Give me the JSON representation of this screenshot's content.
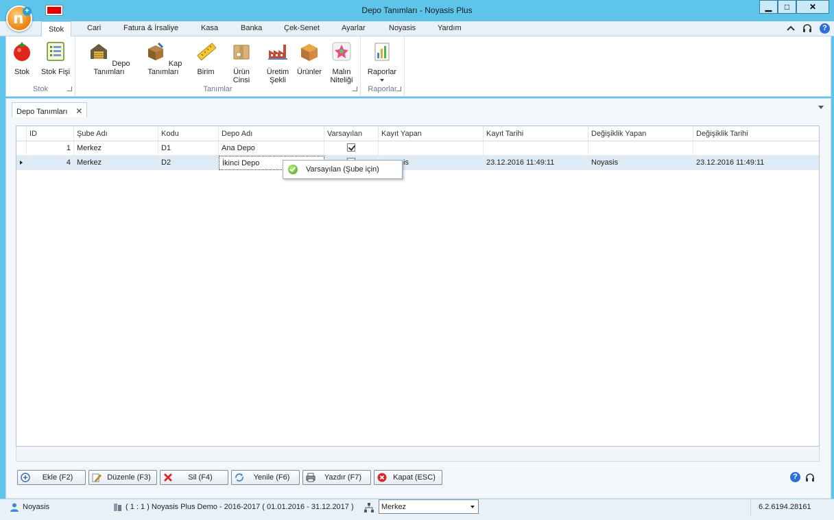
{
  "window": {
    "title": "Depo Tanımları - Noyasis Plus",
    "min": "▁",
    "max": "□",
    "close": "✕"
  },
  "ribbon": {
    "tabs": [
      "Stok",
      "Cari",
      "Fatura & İrsaliye",
      "Kasa",
      "Banka",
      "Çek-Senet",
      "Ayarlar",
      "Noyasis",
      "Yardım"
    ],
    "groups": {
      "stok": {
        "label": "Stok",
        "buttons": [
          "Stok",
          "Stok Fişi"
        ]
      },
      "tanimlar": {
        "label": "Tanımlar",
        "buttons": [
          "Depo Tanımları",
          "Kap Tanımları",
          "Birim",
          "Ürün Cinsi",
          "Üretim Şekli",
          "Ürünler",
          "Malın Niteliği"
        ]
      },
      "raporlar": {
        "label": "Raporlar",
        "buttons": [
          "Raporlar"
        ]
      }
    }
  },
  "document": {
    "tab": "Depo Tanımları",
    "tab_close": "✕"
  },
  "grid": {
    "columns": [
      "ID",
      "Şube Adı",
      "Kodu",
      "Depo Adı",
      "Varsayılan",
      "Kayıt Yapan",
      "Kayıt Tarihi",
      "Değişiklik Yapan",
      "Değişiklik Tarihi"
    ],
    "rows": [
      {
        "id": "1",
        "sube": "Merkez",
        "kodu": "D1",
        "depo": "Ana Depo",
        "varsayilan": true,
        "kayit_yapan": "",
        "kayit_tarihi": "",
        "degisiklik_yapan": "",
        "degisiklik_tarihi": ""
      },
      {
        "id": "4",
        "sube": "Merkez",
        "kodu": "D2",
        "depo": "İkinci Depo",
        "varsayilan": false,
        "kayit_yapan": "is",
        "kayit_tarihi": "23.12.2016 11:49:11",
        "degisiklik_yapan": "Noyasis",
        "degisiklik_tarihi": "23.12.2016 11:49:11"
      }
    ]
  },
  "popup": {
    "label": "Varsayılan (Şube için)"
  },
  "buttons": {
    "ekle": "Ekle (F2)",
    "duzenle": "Düzenle (F3)",
    "sil": "Sil (F4)",
    "yenile": "Yenile (F6)",
    "yazdir": "Yazdır (F7)",
    "kapat": "Kapat (ESC)"
  },
  "status": {
    "user": "Noyasis",
    "company": "( 1 : 1 )  Noyasis Plus Demo - 2016-2017  ( 01.01.2016 - 31.12.2017 )",
    "branch": "Merkez",
    "version": "6.2.6194.28161"
  },
  "help_glyph": "?",
  "logo_letter": "n",
  "logo_plus": "+"
}
